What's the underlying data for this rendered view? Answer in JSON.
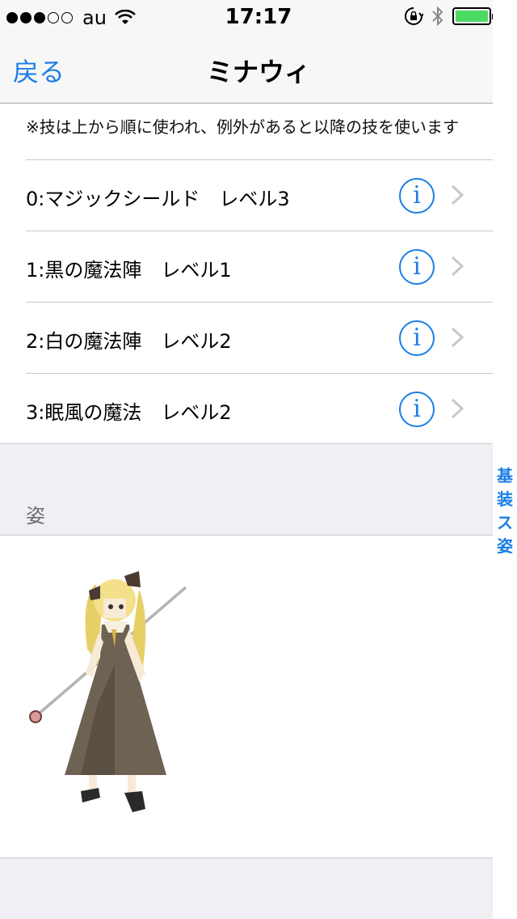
{
  "status_bar": {
    "carrier": "au",
    "time": "17:17"
  },
  "nav": {
    "back_label": "戻る",
    "title": "ミナウィ"
  },
  "skills": {
    "note": "※技は上から順に使われ、例外があると以降の技を使います",
    "items": [
      {
        "label": "0:マジックシールド　レベル3"
      },
      {
        "label": "1:黒の魔法陣　レベル1"
      },
      {
        "label": "2:白の魔法陣　レベル2"
      },
      {
        "label": "3:眠風の魔法　レベル2"
      }
    ],
    "info_glyph": "i"
  },
  "appearance": {
    "header": "姿"
  },
  "index": [
    "基",
    "装",
    "ス",
    "姿"
  ],
  "colors": {
    "accent": "#1a7ee6",
    "battery": "#4cd964",
    "background": "#efeff4"
  }
}
